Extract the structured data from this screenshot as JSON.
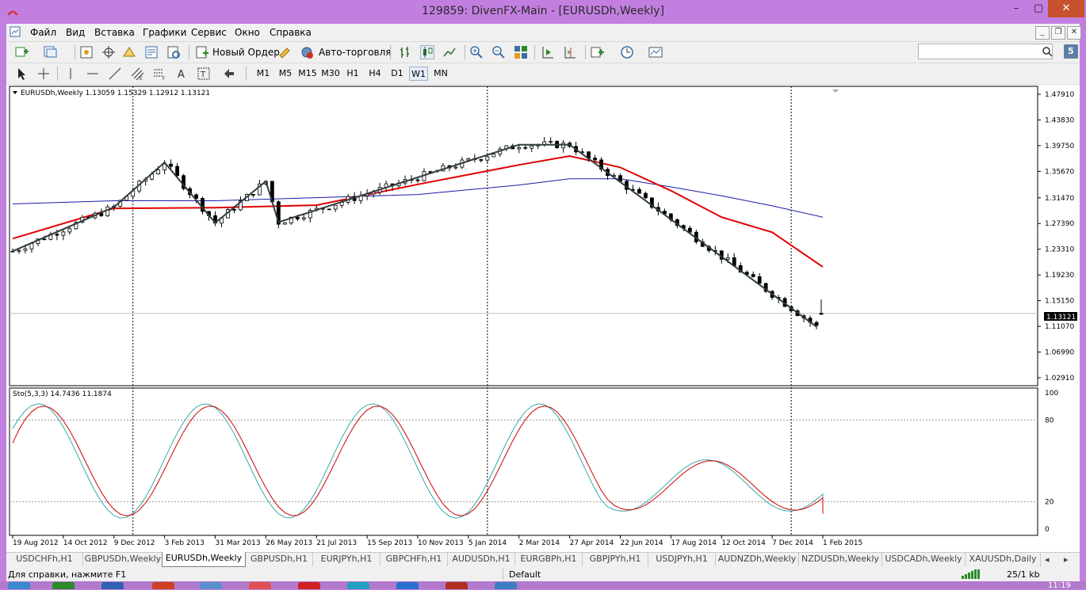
{
  "window": {
    "title": "129859: DivenFX-Main - [EURUSDh,Weekly]",
    "min_label": "–",
    "max_label": "▢",
    "close_label": "✕"
  },
  "menu": {
    "items": [
      "Файл",
      "Вид",
      "Вставка",
      "Графики",
      "Сервис",
      "Окно",
      "Справка"
    ],
    "mdi_min": "_",
    "mdi_restore": "❐",
    "mdi_close": "✕"
  },
  "toolbar": {
    "new_order_label": "Новый Ордер",
    "auto_trading_label": "Авто-торговля",
    "search_placeholder": "",
    "notif_count": "5"
  },
  "timeframes": {
    "items": [
      "M1",
      "M5",
      "M15",
      "M30",
      "H1",
      "H4",
      "D1",
      "W1",
      "MN"
    ],
    "active": "W1"
  },
  "chart": {
    "symbol_info": "EURUSDh,Weekly  1.13059 1.15329 1.12912 1.13121",
    "current_price": "1.13121",
    "price_ticks": [
      "1.47910",
      "1.43830",
      "1.39750",
      "1.35670",
      "1.31470",
      "1.27390",
      "1.23310",
      "1.19230",
      "1.15150",
      "1.11070",
      "1.06990",
      "1.02910"
    ],
    "date_ticks": [
      "19 Aug 2012",
      "14 Oct 2012",
      "9 Dec 2012",
      "3 Feb 2013",
      "31 Mar 2013",
      "26 May 2013",
      "21 Jul 2013",
      "15 Sep 2013",
      "10 Nov 2013",
      "5 Jan 2014",
      "2 Mar 2014",
      "27 Apr 2014",
      "22 Jun 2014",
      "17 Aug 2014",
      "12 Oct 2014",
      "7 Dec 2014",
      "1 Feb 2015"
    ],
    "indicator_info": "Sto(5,3,3) 14.7436 11.1874",
    "stoch_ticks": [
      "100",
      "80",
      "20",
      "0"
    ],
    "colors": {
      "candle": "#000000",
      "ma_fast": "#e00000",
      "ma_slow": "#1a1aa8",
      "zigzag": "#2f3f3f",
      "stoch_main": "#3aa9a9",
      "stoch_signal": "#d00000"
    }
  },
  "chart_data": {
    "type": "line",
    "title": "EURUSDh,Weekly",
    "ohlc_last": {
      "open": 1.13059,
      "high": 1.15329,
      "low": 1.12912,
      "close": 1.13121
    },
    "zigzag": {
      "x": [
        "19 Aug 2012",
        "9 Dec 2012",
        "3 Feb 2013",
        "31 Mar 2013",
        "26 May 2013",
        "9 Jun 2013",
        "2 Mar 2014",
        "27 Apr 2014",
        "25 Jan 2015"
      ],
      "y": [
        1.23,
        1.3,
        1.371,
        1.275,
        1.341,
        1.276,
        1.399,
        1.399,
        1.11
      ]
    },
    "ma_fast_approx": {
      "x": [
        "19 Aug 2012",
        "9 Dec 2012",
        "31 Mar 2013",
        "21 Jul 2013",
        "10 Nov 2013",
        "2 Mar 2014",
        "27 Apr 2014",
        "22 Jun 2014",
        "17 Aug 2014",
        "12 Oct 2014",
        "7 Dec 2014",
        "1 Feb 2015"
      ],
      "y": [
        1.25,
        1.298,
        1.299,
        1.303,
        1.336,
        1.367,
        1.381,
        1.363,
        1.326,
        1.284,
        1.26,
        1.205
      ]
    },
    "ma_slow_approx": {
      "x": [
        "19 Aug 2012",
        "9 Dec 2012",
        "31 Mar 2013",
        "21 Jul 2013",
        "10 Nov 2013",
        "2 Mar 2014",
        "27 Apr 2014",
        "22 Jun 2014",
        "17 Aug 2014",
        "12 Oct 2014",
        "7 Dec 2014",
        "1 Feb 2015"
      ],
      "y": [
        1.305,
        1.31,
        1.31,
        1.315,
        1.32,
        1.335,
        1.345,
        1.345,
        1.332,
        1.318,
        1.302,
        1.284
      ]
    },
    "ylim": [
      1.0291,
      1.4791
    ],
    "stochastic": {
      "k_last": 14.7436,
      "d_last": 11.1874,
      "levels": [
        80,
        20
      ],
      "ylim": [
        0,
        100
      ]
    }
  },
  "tabs": {
    "items": [
      "USDCHFh,H1",
      "GBPUSDh,Weekly",
      "EURUSDh,Weekly",
      "GBPUSDh,H1",
      "EURJPYh,H1",
      "GBPCHFh,H1",
      "AUDUSDh,H1",
      "EURGBPh,H1",
      "GBPJPYh,H1",
      "USDJPYh,H1",
      "AUDNZDh,Weekly",
      "NZDUSDh,Weekly",
      "USDCADh,Weekly",
      "XAUUSDh,Daily"
    ],
    "active": "EURUSDh,Weekly"
  },
  "status": {
    "help": "Для справки, нажмите F1",
    "profile": "Default",
    "traffic": "25/1 kb"
  },
  "taskbar": {
    "clock": "11:19"
  }
}
